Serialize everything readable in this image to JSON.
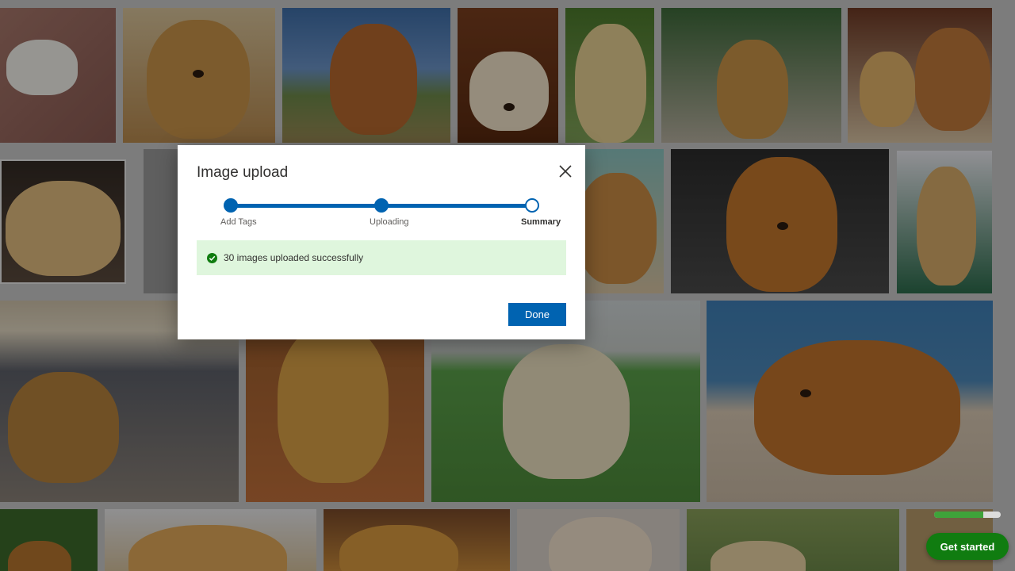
{
  "modal": {
    "title": "Image upload",
    "close_icon": "close-icon",
    "steps": [
      {
        "label": "Add Tags",
        "state": "complete"
      },
      {
        "label": "Uploading",
        "state": "complete"
      },
      {
        "label": "Summary",
        "state": "current"
      }
    ],
    "success_message": "30 images uploaded successfully",
    "success_icon": "checkmark-circle-icon",
    "done_label": "Done"
  },
  "floating": {
    "get_started_label": "Get started",
    "progress": 0.74
  },
  "colors": {
    "accent": "#0063b1",
    "success_bg": "#dff6dd",
    "success_icon": "#107c10",
    "cta": "#107c10"
  }
}
